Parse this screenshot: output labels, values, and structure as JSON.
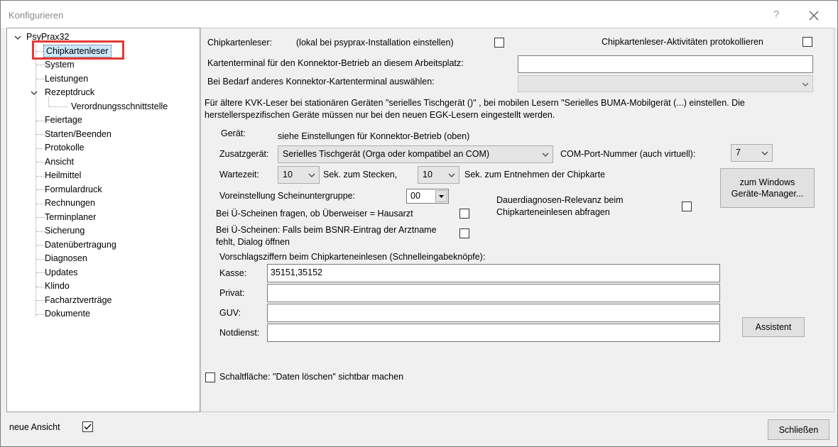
{
  "window": {
    "title": "Konfigurieren",
    "help_symbol": "?"
  },
  "tree": {
    "root": "PsyPrax32",
    "items": [
      {
        "label": "Chipkartenleser"
      },
      {
        "label": "System"
      },
      {
        "label": "Leistungen"
      },
      {
        "label": "Rezeptdruck"
      },
      {
        "label": "Verordnungsschnittstelle"
      },
      {
        "label": "Feiertage"
      },
      {
        "label": "Starten/Beenden"
      },
      {
        "label": "Protokolle"
      },
      {
        "label": "Ansicht"
      },
      {
        "label": "Heilmittel"
      },
      {
        "label": "Formulardruck"
      },
      {
        "label": "Rechnungen"
      },
      {
        "label": "Terminplaner"
      },
      {
        "label": "Sicherung"
      },
      {
        "label": "Datenübertragung"
      },
      {
        "label": "Diagnosen"
      },
      {
        "label": "Updates"
      },
      {
        "label": "Klindo"
      },
      {
        "label": "Facharztverträge"
      },
      {
        "label": "Dokumente"
      }
    ]
  },
  "main": {
    "chipkartenleser_label": "Chipkartenleser:",
    "lokal_label": "(lokal bei psyprax-Installation einstellen)",
    "protokollieren_label": "Chipkartenleser-Aktivitäten protokollieren",
    "kartenterminal_label": "Kartenterminal für den Konnektor-Betrieb an diesem Arbeitsplatz:",
    "kartenterminal_value": "",
    "bei_bedarf_label": "Bei Bedarf anderes Konnektor-Kartenterminal auswählen:",
    "bei_bedarf_value": "",
    "info_line1": "Für ältere KVK-Leser bei stationären Geräten \"serielles Tischgerät ()\" , bei mobilen Lesern \"Serielles BUMA-Mobilgerät (...) einstellen. Die",
    "info_line2": "herstellerspezifischen Geräte müssen nur bei den neuen EGK-Lesern eingestellt werden.",
    "geraet_label": "Gerät:",
    "geraet_value": "siehe Einstellungen für Konnektor-Betrieb (oben)",
    "zusatzgeraet_label": "Zusatzgerät:",
    "zusatzgeraet_value": "Serielles Tischgerät (Orga oder kompatibel an COM)",
    "com_port_label": "COM-Port-Nummer (auch virtuell):",
    "com_port_value": "7",
    "wartezeit_label": "Wartezeit:",
    "wartezeit_stecken_value": "10",
    "sek_stecken_label": "Sek. zum Stecken,",
    "wartezeit_entnehmen_value": "10",
    "sek_entnehmen_label": "Sek. zum Entnehmen der Chipkarte",
    "windows_button_line1": "zum Windows",
    "windows_button_line2": "Geräte-Manager...",
    "scheinuntergruppe_label": "Voreinstellung Scheinuntergruppe:",
    "scheinuntergruppe_value": "00",
    "dauerdiagnosen_line1": "Dauerdiagnosen-Relevanz beim",
    "dauerdiagnosen_line2": "Chipkarteneinlesen abfragen",
    "ue_scheine_hausarzt_label": "Bei Ü-Scheinen fragen, ob Überweiser = Hausarzt",
    "ue_scheine_bsnr_line1": "Bei Ü-Scheinen: Falls beim BSNR-Eintrag der Arztname",
    "ue_scheine_bsnr_line2": "fehlt, Dialog öffnen",
    "vorschlag_label": "Vorschlagsziffern beim Chipkarteneinlesen (Schnelleingabeknöpfe):",
    "kasse_label": "Kasse:",
    "kasse_value": "35151,35152",
    "privat_label": "Privat:",
    "privat_value": "",
    "guv_label": "GUV:",
    "guv_value": "",
    "notdienst_label": "Notdienst:",
    "notdienst_value": "",
    "assistent_label": "Assistent",
    "daten_loeschen_label": "Schaltfläche: \"Daten löschen\" sichtbar machen"
  },
  "footer": {
    "neue_ansicht_label": "neue Ansicht",
    "neue_ansicht_checked": true,
    "schliessen_label": "Schließen"
  },
  "colors": {
    "selection_bg": "#cce8ff",
    "highlight_border": "#e53935"
  }
}
